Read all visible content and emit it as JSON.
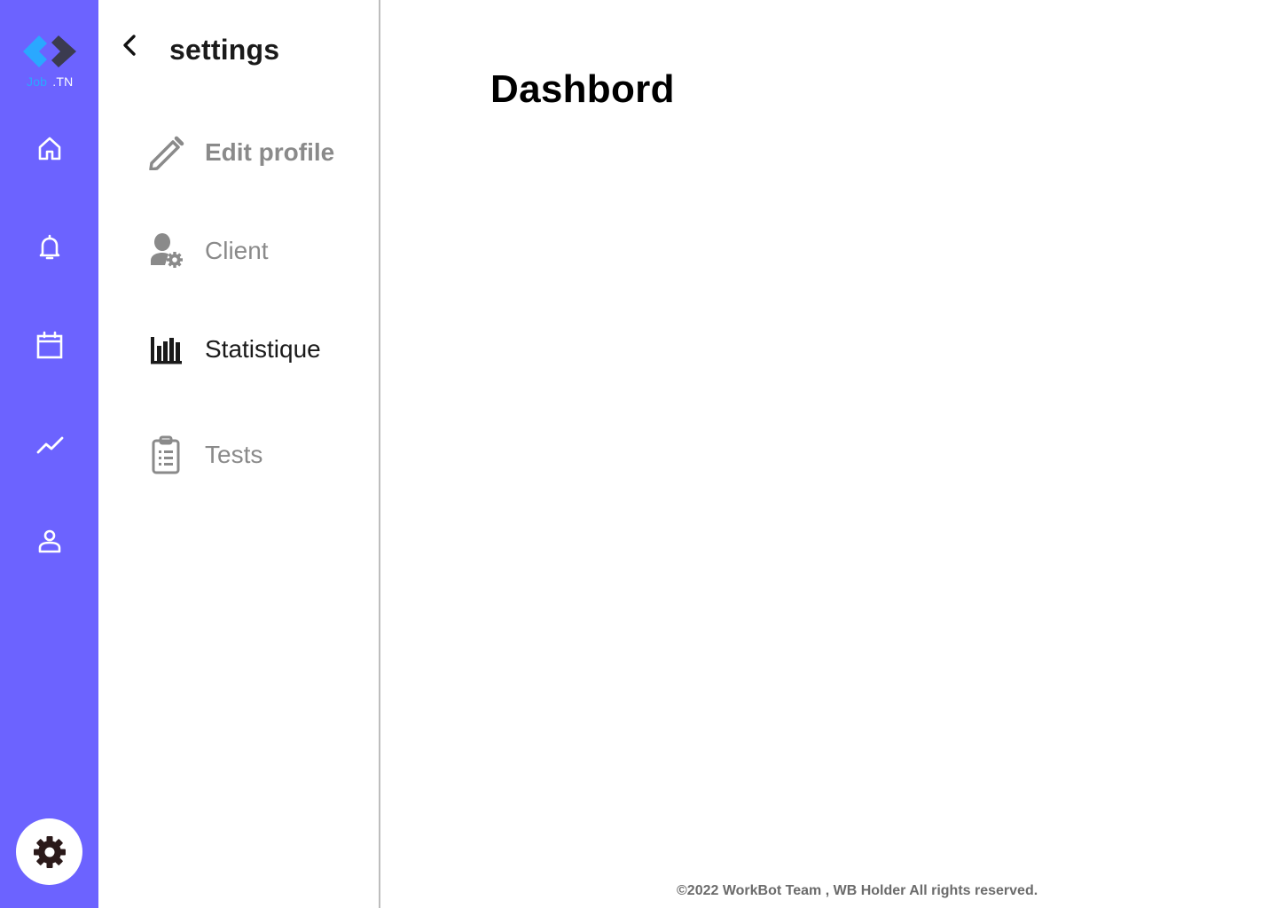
{
  "brand": {
    "name_part1": "Job",
    "name_part2": ".TN"
  },
  "rail": {
    "items": [
      {
        "name": "home",
        "icon": "home-icon"
      },
      {
        "name": "notifications",
        "icon": "bell-icon"
      },
      {
        "name": "calendar",
        "icon": "calendar-icon"
      },
      {
        "name": "statistics",
        "icon": "trending-icon"
      },
      {
        "name": "profile",
        "icon": "user-icon"
      }
    ],
    "settings_icon": "gear-icon"
  },
  "panel": {
    "title": "settings",
    "back_icon": "chevron-left-icon",
    "items": [
      {
        "label": "Edit profile",
        "icon": "pencil-icon",
        "active": false
      },
      {
        "label": "Client",
        "icon": "user-gear-icon",
        "active": false
      },
      {
        "label": "Statistique",
        "icon": "bar-chart-icon",
        "active": true
      },
      {
        "label": "Tests",
        "icon": "clipboard-list-icon",
        "active": false
      }
    ]
  },
  "main": {
    "title": "Dashbord"
  },
  "footer": {
    "text": "©2022 WorkBot Team , WB Holder All rights reserved."
  },
  "colors": {
    "rail_bg": "#6C63FF",
    "active_text": "#1a1a1a",
    "inactive_text": "#8a8a8a",
    "gear_fill": "#2b1a1a",
    "logo_blue": "#2AA8FF",
    "logo_dark": "#3b3b4f"
  }
}
